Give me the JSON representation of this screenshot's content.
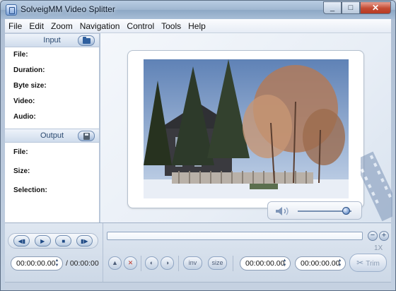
{
  "window": {
    "title": "SolveigMM Video Splitter",
    "close_glyph": "✕",
    "maximize_glyph": "□",
    "minimize_glyph": "_"
  },
  "menu": [
    "File",
    "Edit",
    "Zoom",
    "Navigation",
    "Control",
    "Tools",
    "Help"
  ],
  "input_panel": {
    "title": "Input",
    "open_icon": "folder-open-icon",
    "fields": [
      "File:",
      "Duration:",
      "Byte size:",
      "Video:",
      "Audio:"
    ]
  },
  "output_panel": {
    "title": "Output",
    "save_icon": "save-icon",
    "fields": [
      "File:",
      "Size:",
      "Selection:"
    ]
  },
  "preview": {
    "volume_level": 0.9
  },
  "player": {
    "buttons": [
      "prev-marker",
      "play",
      "stop",
      "next-marker"
    ],
    "glyphs": [
      "◀▮",
      "▶",
      "■",
      "▮▶"
    ]
  },
  "timeline": {
    "zoom_out": "−",
    "zoom_in": "+",
    "zoom_level": "1X"
  },
  "position": {
    "current_time": "00:00:00.00",
    "duration": "/ 00:00:00",
    "sel_start": "00:00:00.00",
    "sel_end": "00:00:00.00"
  },
  "buttons": {
    "inv": "inv",
    "size": "size",
    "trim": "Trim"
  },
  "colors": {
    "accent": "#2f5f9e",
    "panel_header": "#cfdcec",
    "close_red": "#c44b33"
  }
}
